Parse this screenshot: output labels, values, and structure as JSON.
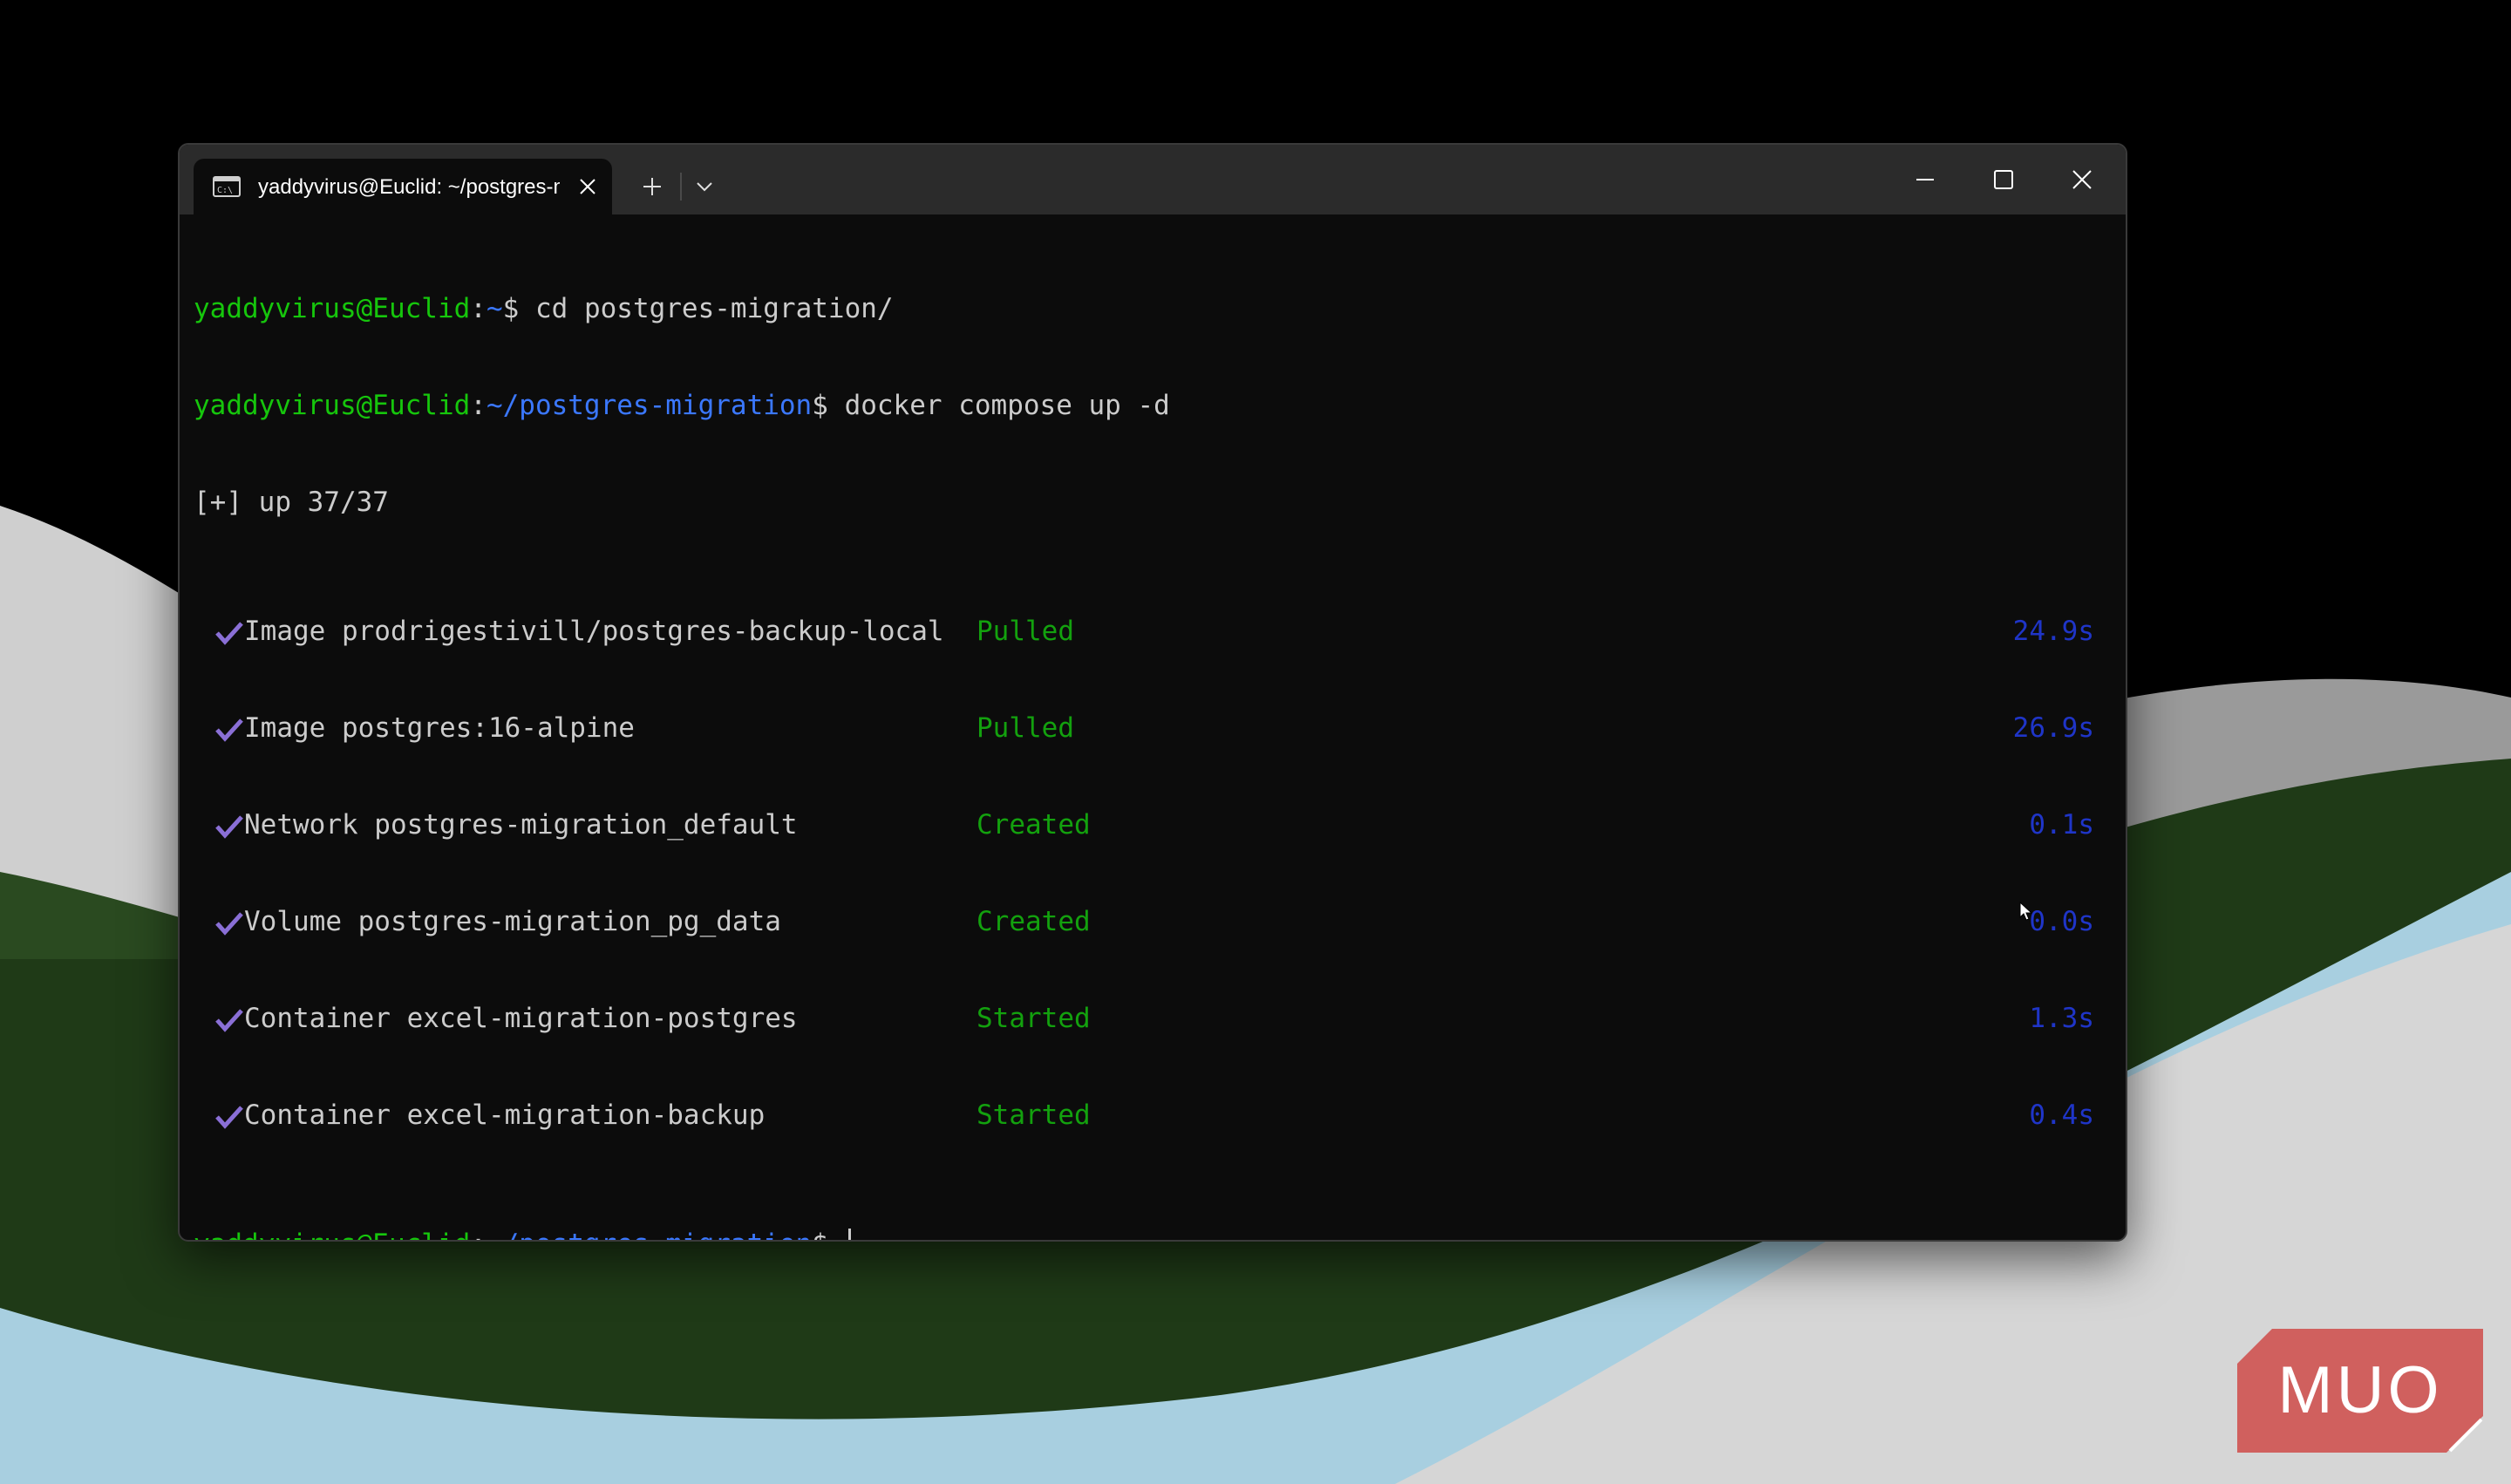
{
  "terminal": {
    "tab_title": "yaddyvirus@Euclid: ~/postgres-migration",
    "lines": {
      "l1": {
        "user": "yaddyvirus@Euclid",
        "colon": ":",
        "path": "~",
        "prompt": "$",
        "cmd": " cd postgres-migration/"
      },
      "l2": {
        "user": "yaddyvirus@Euclid",
        "colon": ":",
        "path": "~/postgres-migration",
        "prompt": "$",
        "cmd": " docker compose up -d"
      },
      "l3": {
        "text": "[+] up 37/37"
      },
      "l10": {
        "user": "yaddyvirus@Euclid",
        "colon": ":",
        "path": "~/postgres-migration",
        "prompt": "$ "
      }
    },
    "resources": [
      {
        "name": "Image prodrigestivill/postgres-backup-local",
        "status": "Pulled",
        "duration": "24.9s"
      },
      {
        "name": "Image postgres:16-alpine",
        "status": "Pulled",
        "duration": "26.9s"
      },
      {
        "name": "Network postgres-migration_default",
        "status": "Created",
        "duration": "0.1s"
      },
      {
        "name": "Volume postgres-migration_pg_data",
        "status": "Created",
        "duration": "0.0s"
      },
      {
        "name": "Container excel-migration-postgres",
        "status": "Started",
        "duration": "1.3s"
      },
      {
        "name": "Container excel-migration-backup",
        "status": "Started",
        "duration": "0.4s"
      }
    ]
  },
  "icons": {
    "tab": "terminal-icon",
    "tab_close": "close-icon",
    "new_tab": "plus-icon",
    "dropdown": "chevron-down-icon",
    "minimize": "minimize-icon",
    "maximize": "maximize-icon",
    "close": "close-icon",
    "check": "check-icon",
    "pointer": "mouse-pointer-icon"
  },
  "colors": {
    "prompt_user": "#16c60c",
    "prompt_path": "#3b78ff",
    "status": "#13a10e",
    "duration": "#1f35c8",
    "check": "#8a6fd6",
    "logo_bg": "#d0605e"
  },
  "watermark": {
    "text": "MUO"
  }
}
